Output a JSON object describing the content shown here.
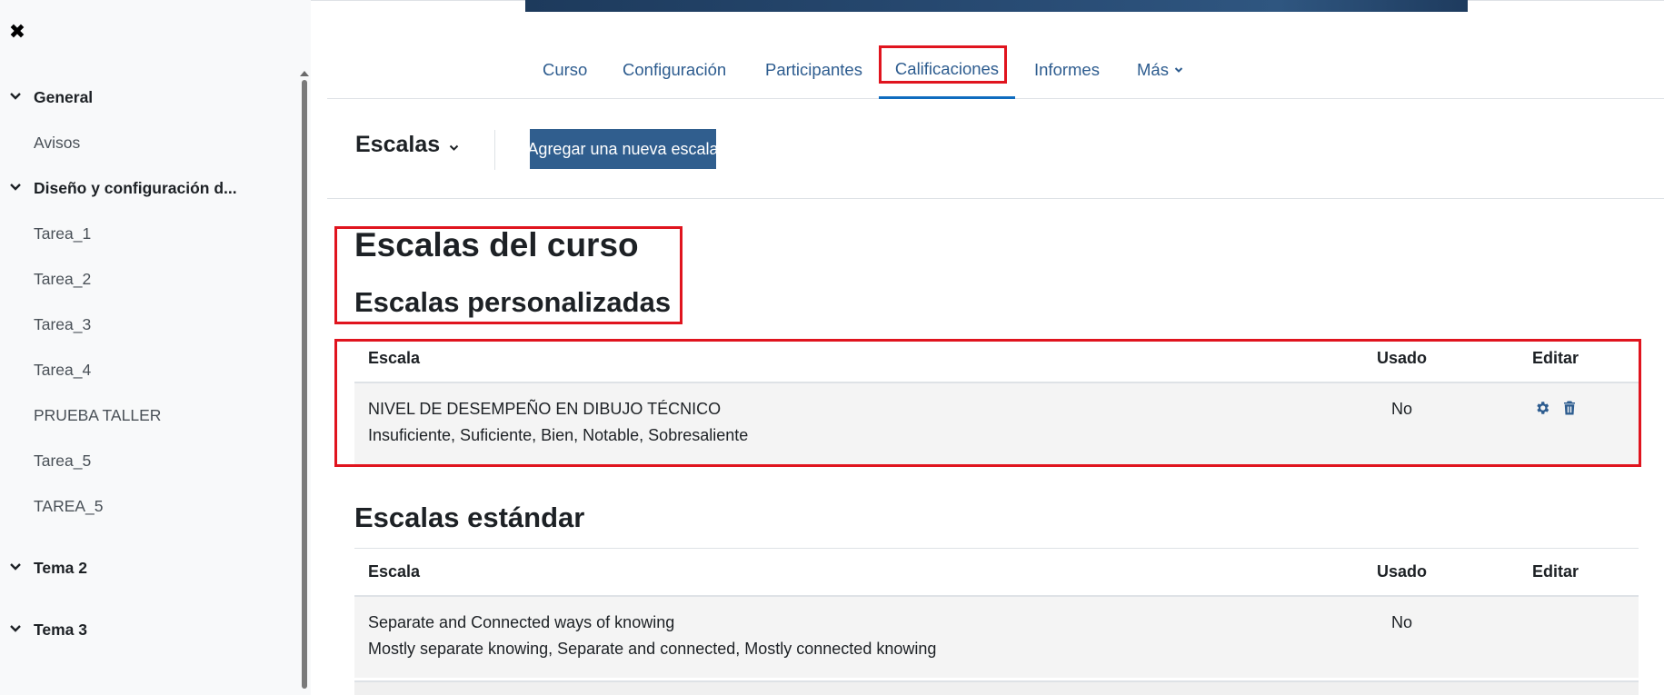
{
  "drawer": {
    "close_icon": "close-icon",
    "sections": [
      {
        "title": "General",
        "items": [
          "Avisos"
        ]
      },
      {
        "title": "Diseño y configuración d...",
        "items": [
          "Tarea_1",
          "Tarea_2",
          "Tarea_3",
          "Tarea_4",
          "PRUEBA TALLER",
          "Tarea_5",
          "TAREA_5"
        ]
      },
      {
        "title": "Tema 2",
        "items": []
      },
      {
        "title": "Tema 3",
        "items": []
      }
    ]
  },
  "secondary_nav": {
    "items": [
      "Curso",
      "Configuración",
      "Participantes",
      "Calificaciones",
      "Informes",
      "Más"
    ],
    "active": "Calificaciones"
  },
  "tertiary": {
    "select_label": "Escalas",
    "add_button": "Agregar una nueva escala"
  },
  "page": {
    "title": "Escalas del curso",
    "custom_heading": "Escalas personalizadas",
    "standard_heading": "Escalas estándar"
  },
  "custom_table": {
    "headers": [
      "Escala",
      "Usado",
      "Editar"
    ],
    "rows": [
      {
        "name": "NIVEL DE DESEMPEÑO EN DIBUJO TÉCNICO",
        "items": "Insuficiente, Suficiente, Bien, Notable, Sobresaliente",
        "used": "No",
        "edit_icons": [
          "gear-icon",
          "trash-icon"
        ]
      }
    ]
  },
  "standard_table": {
    "headers": [
      "Escala",
      "Usado",
      "Editar"
    ],
    "rows": [
      {
        "name": "Separate and Connected ways of knowing",
        "items": "Mostly separate knowing, Separate and connected, Mostly connected knowing",
        "used": "No"
      }
    ]
  },
  "colors": {
    "accent": "#0f6cbf",
    "primary_button": "#305e8e",
    "highlight": "#e0141e",
    "banner": "#1d3a5c"
  }
}
